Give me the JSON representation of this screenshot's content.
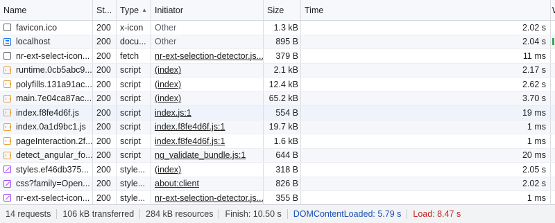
{
  "headers": {
    "name": "Name",
    "status": "St...",
    "type": "Type",
    "initiator": "Initiator",
    "size": "Size",
    "time": "Time",
    "waterfall": "W"
  },
  "rows": [
    {
      "icon": "blank",
      "name": "favicon.ico",
      "status": "200",
      "type": "x-icon",
      "initiator": "Other",
      "initiator_link": false,
      "size": "1.3 kB",
      "time": "2.02 s",
      "waterfall": false
    },
    {
      "icon": "doc",
      "name": "localhost",
      "status": "200",
      "type": "docu...",
      "initiator": "Other",
      "initiator_link": false,
      "size": "895 B",
      "time": "2.04 s",
      "waterfall": true
    },
    {
      "icon": "blank",
      "name": "nr-ext-select-icon...",
      "status": "200",
      "type": "fetch",
      "initiator": "nr-ext-selection-detector.js...",
      "initiator_link": true,
      "size": "379 B",
      "time": "11 ms",
      "waterfall": false
    },
    {
      "icon": "script",
      "name": "runtime.0cb5abc9...",
      "status": "200",
      "type": "script",
      "initiator": "(index)",
      "initiator_link": true,
      "size": "2.1 kB",
      "time": "2.17 s",
      "waterfall": false
    },
    {
      "icon": "script",
      "name": "polyfills.131a91ac...",
      "status": "200",
      "type": "script",
      "initiator": "(index)",
      "initiator_link": true,
      "size": "12.4 kB",
      "time": "2.62 s",
      "waterfall": false
    },
    {
      "icon": "script",
      "name": "main.7e04ca87ac...",
      "status": "200",
      "type": "script",
      "initiator": "(index)",
      "initiator_link": true,
      "size": "65.2 kB",
      "time": "3.70 s",
      "waterfall": false
    },
    {
      "icon": "script",
      "name": "index.f8fe4d6f.js",
      "status": "200",
      "type": "script",
      "initiator": "index.js:1",
      "initiator_link": true,
      "size": "554 B",
      "time": "19 ms",
      "waterfall": false
    },
    {
      "icon": "script",
      "name": "index.0a1d9bc1.js",
      "status": "200",
      "type": "script",
      "initiator": "index.f8fe4d6f.js:1",
      "initiator_link": true,
      "size": "19.7 kB",
      "time": "1 ms",
      "waterfall": false
    },
    {
      "icon": "script",
      "name": "pageInteraction.2f...",
      "status": "200",
      "type": "script",
      "initiator": "index.f8fe4d6f.js:1",
      "initiator_link": true,
      "size": "1.6 kB",
      "time": "1 ms",
      "waterfall": false
    },
    {
      "icon": "script",
      "name": "detect_angular_fo...",
      "status": "200",
      "type": "script",
      "initiator": "ng_validate_bundle.js:1",
      "initiator_link": true,
      "size": "644 B",
      "time": "20 ms",
      "waterfall": false
    },
    {
      "icon": "style",
      "name": "styles.ef46db375...",
      "status": "200",
      "type": "style...",
      "initiator": "(index)",
      "initiator_link": true,
      "size": "318 B",
      "time": "2.05 s",
      "waterfall": false
    },
    {
      "icon": "style",
      "name": "css?family=Open...",
      "status": "200",
      "type": "style...",
      "initiator": "about:client",
      "initiator_link": true,
      "size": "826 B",
      "time": "2.02 s",
      "waterfall": false
    },
    {
      "icon": "style",
      "name": "nr-ext-select-icon...",
      "status": "200",
      "type": "style...",
      "initiator": "nr-ext-selection-detector.js...",
      "initiator_link": true,
      "size": "355 B",
      "time": "1 ms",
      "waterfall": false
    }
  ],
  "status_bar": {
    "requests": "14 requests",
    "transferred": "106 kB transferred",
    "resources": "284 kB resources",
    "finish": "Finish: 10.50 s",
    "dcl": "DOMContentLoaded: 5.79 s",
    "load": "Load: 8.47 s"
  },
  "colors": {
    "dcl": "#1a4fb4",
    "load": "#c5221f",
    "waterfall": "#34a853"
  }
}
